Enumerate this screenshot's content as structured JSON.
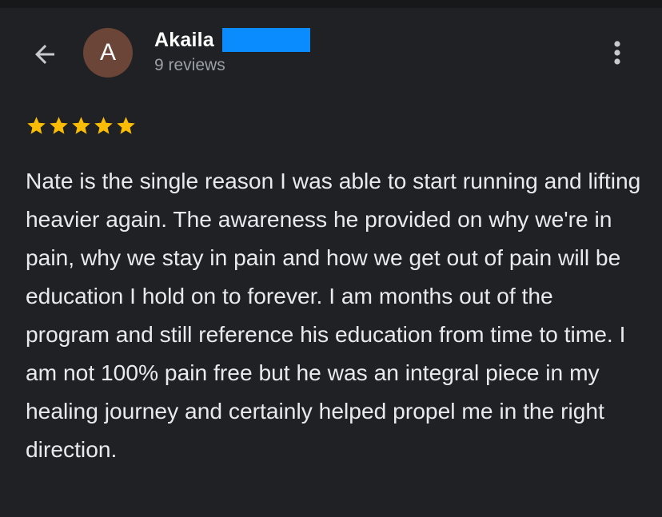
{
  "header": {
    "author_name": "Akaila",
    "avatar_initial": "A",
    "review_count": "9 reviews",
    "back_icon": "arrow-left-icon",
    "more_icon": "more-vertical-icon",
    "avatar_color": "#6b4537",
    "redaction_color": "#0a8cff"
  },
  "review": {
    "rating": 5,
    "max_rating": 5,
    "star_color": "#fbbc04",
    "text": "Nate is the single reason I was able to start running and lifting heavier again. The awareness he provided on why we're in pain, why we stay in pain and how we get out of pain will be education I hold on to forever. I am months out of the program and still reference his education from time to time. I am not 100% pain free but he was an integral piece in my healing journey and certainly helped propel me in the right direction."
  }
}
